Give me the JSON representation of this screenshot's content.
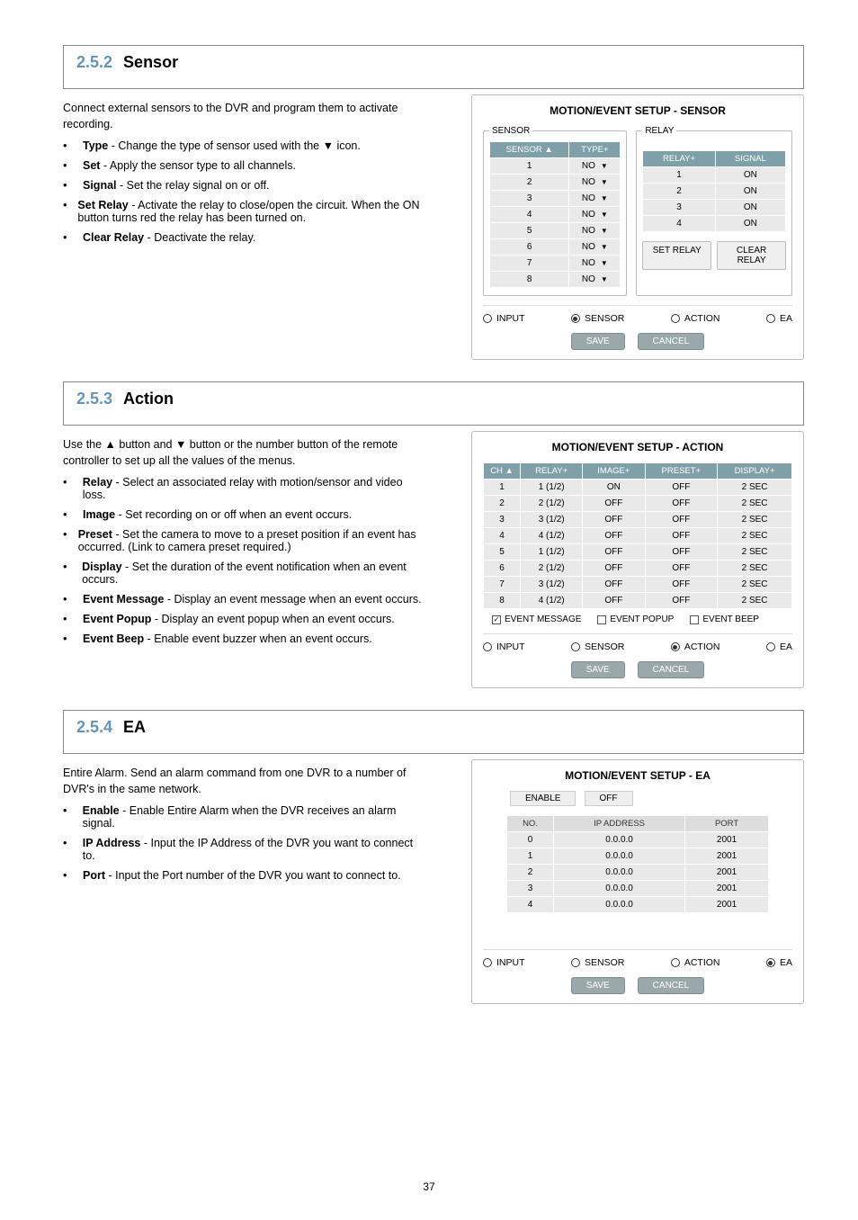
{
  "page_number": "37",
  "sections": {
    "sensor": {
      "num": "2.5.2",
      "title": "Sensor",
      "intro": "Connect external sensors to the DVR and program them to activate recording.",
      "bullets": [
        {
          "label": "Type",
          "text": "- Change the type of sensor used with the ▼ icon."
        },
        {
          "label": "Set",
          "text": "- Apply the sensor type to all channels."
        },
        {
          "label": "Signal",
          "text": "- Set the relay signal on or off."
        },
        {
          "label": "Set Relay",
          "text": "- Activate the relay to close/open the circuit. When the ON button turns red the relay has been turned on."
        },
        {
          "label": "Clear Relay",
          "text": "- Deactivate the relay."
        }
      ]
    },
    "action": {
      "num": "2.5.3",
      "title": "Action",
      "intro_lines": [
        "Use the ▲ button and ▼ button or the number button of the remote controller to set up all the values of the menus."
      ],
      "bullets": [
        {
          "label": "Relay",
          "text": "- Select an associated relay with motion/sensor and video loss."
        },
        {
          "label": "Image",
          "text": "- Set recording on or off when an event occurs."
        },
        {
          "label": "Preset",
          "text": "- Set the camera to move to a preset position if an event has occurred. (Link to camera preset required.)"
        },
        {
          "label": "Display",
          "text": "- Set the duration of the event notification when an event occurs."
        },
        {
          "label": "Event Message",
          "text": "- Display an event message when an event occurs."
        },
        {
          "label": "Event Popup",
          "text": "- Display an event popup when an event occurs."
        },
        {
          "label": "Event Beep",
          "text": "- Enable event buzzer when an event occurs."
        }
      ]
    },
    "ea": {
      "num": "2.5.4",
      "title": "EA",
      "intro": "Entire Alarm. Send an alarm command from one DVR to a number of DVR's in the same network.",
      "bullets": [
        {
          "label": "Enable",
          "text": "- Enable Entire Alarm when the DVR receives an alarm signal."
        },
        {
          "label": "IP Address",
          "text": "- Input the IP Address of the DVR you want to connect to."
        },
        {
          "label": "Port",
          "text": "- Input the Port number of the DVR you want to connect to."
        }
      ]
    }
  },
  "shot_sensor": {
    "title": "MOTION/EVENT SETUP - SENSOR",
    "fieldset_sensor": "SENSOR",
    "fieldset_relay": "RELAY",
    "sensor_col": "SENSOR ▲",
    "type_col": "TYPE+",
    "sensor_rows": [
      "1",
      "2",
      "3",
      "4",
      "5",
      "6",
      "7",
      "8"
    ],
    "sensor_type": "NO",
    "relay_col": "RELAY+",
    "signal_col": "SIGNAL",
    "relay_rows": [
      {
        "n": "1",
        "s": "ON"
      },
      {
        "n": "2",
        "s": "ON"
      },
      {
        "n": "3",
        "s": "ON"
      },
      {
        "n": "4",
        "s": "ON"
      }
    ],
    "btn_set": "SET RELAY",
    "btn_clear": "CLEAR RELAY",
    "tabs": {
      "input": "INPUT",
      "sensor": "SENSOR",
      "action": "ACTION",
      "ea": "EA",
      "selected": "sensor"
    }
  },
  "shot_action": {
    "title": "MOTION/EVENT SETUP - ACTION",
    "cols": {
      "ch": "CH ▲",
      "relay": "RELAY+",
      "image": "IMAGE+",
      "preset": "PRESET+",
      "display": "DISPLAY+"
    },
    "rows": [
      {
        "ch": "1",
        "relay": "1 (1/2)",
        "image": "ON",
        "preset": "OFF",
        "display": "2 SEC"
      },
      {
        "ch": "2",
        "relay": "2 (1/2)",
        "image": "OFF",
        "preset": "OFF",
        "display": "2 SEC"
      },
      {
        "ch": "3",
        "relay": "3 (1/2)",
        "image": "OFF",
        "preset": "OFF",
        "display": "2 SEC"
      },
      {
        "ch": "4",
        "relay": "4 (1/2)",
        "image": "OFF",
        "preset": "OFF",
        "display": "2 SEC"
      },
      {
        "ch": "5",
        "relay": "1 (1/2)",
        "image": "OFF",
        "preset": "OFF",
        "display": "2 SEC"
      },
      {
        "ch": "6",
        "relay": "2 (1/2)",
        "image": "OFF",
        "preset": "OFF",
        "display": "2 SEC"
      },
      {
        "ch": "7",
        "relay": "3 (1/2)",
        "image": "OFF",
        "preset": "OFF",
        "display": "2 SEC"
      },
      {
        "ch": "8",
        "relay": "4 (1/2)",
        "image": "OFF",
        "preset": "OFF",
        "display": "2 SEC"
      }
    ],
    "evt_msg": "EVENT MESSAGE",
    "evt_popup": "EVENT POPUP",
    "evt_beep": "EVENT BEEP",
    "tabs": {
      "input": "INPUT",
      "sensor": "SENSOR",
      "action": "ACTION",
      "ea": "EA",
      "selected": "action"
    }
  },
  "shot_ea": {
    "title": "MOTION/EVENT SETUP - EA",
    "enable_label": "ENABLE",
    "enable_val": "OFF",
    "cols": {
      "no": "NO.",
      "ip": "IP ADDRESS",
      "port": "PORT"
    },
    "rows": [
      {
        "no": "0",
        "ip": "0.0.0.0",
        "port": "2001"
      },
      {
        "no": "1",
        "ip": "0.0.0.0",
        "port": "2001"
      },
      {
        "no": "2",
        "ip": "0.0.0.0",
        "port": "2001"
      },
      {
        "no": "3",
        "ip": "0.0.0.0",
        "port": "2001"
      },
      {
        "no": "4",
        "ip": "0.0.0.0",
        "port": "2001"
      }
    ],
    "tabs": {
      "input": "INPUT",
      "sensor": "SENSOR",
      "action": "ACTION",
      "ea": "EA",
      "selected": "ea"
    }
  },
  "common": {
    "save": "SAVE",
    "cancel": "CANCEL"
  }
}
